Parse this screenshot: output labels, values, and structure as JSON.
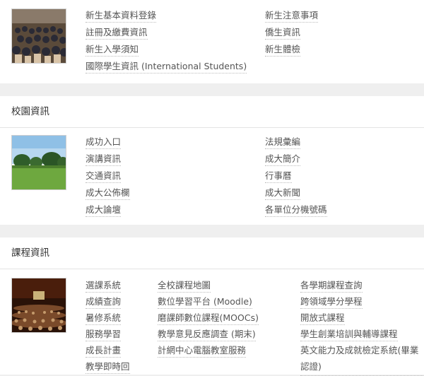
{
  "sections": [
    {
      "heading": "",
      "image_alt": "photo-crowd-ceremony",
      "col1": [
        "新生基本資料登錄",
        "註冊及繳費資訊",
        "新生入學須知",
        "國際學生資訊 (International Students)"
      ],
      "col2": [
        "新生注意事項",
        "僑生資訊",
        "新生體檢"
      ]
    },
    {
      "heading": "校園資訊",
      "image_alt": "photo-campus-lawn",
      "col1": [
        "成功入口",
        "演講資訊",
        "交通資訊",
        "成大公佈欄",
        "成大論壇"
      ],
      "col2": [
        "法規彙編",
        "成大簡介",
        "行事曆",
        "成大新聞",
        "各單位分機號碼"
      ]
    },
    {
      "heading": "課程資訊",
      "image_alt": "photo-lecture-hall",
      "col1": [
        "選課系統",
        "成績查詢",
        "暑修系統",
        "服務學習",
        "成長計畫",
        "教學即時回"
      ],
      "col2": [
        "全校課程地圖",
        "數位學習平台 (Moodle)",
        "磨課師數位課程(MOOCs)",
        "教學意見反應調查 (期末)",
        "計網中心電腦教室服務"
      ],
      "col3": [
        "各學期課程查詢",
        "跨領域學分學程",
        "開放式課程",
        "學生創業培訓與輔導課程",
        "英文能力及成就檢定系統(畢業認證)"
      ]
    }
  ]
}
